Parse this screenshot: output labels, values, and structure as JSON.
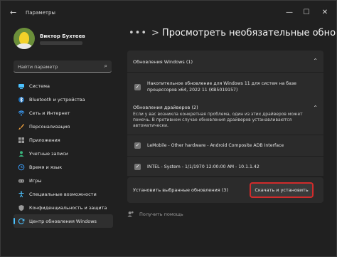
{
  "window": {
    "title": "Параметры",
    "back_icon": "back-arrow-icon",
    "controls": {
      "minimize": "—",
      "maximize": "☐",
      "close": "✕"
    }
  },
  "profile": {
    "name": "Виктор Бухтеев"
  },
  "search": {
    "placeholder": "Найти параметр"
  },
  "sidebar": {
    "items": [
      {
        "label": "Система",
        "icon": "monitor-icon",
        "color": "#4cc2ff",
        "active": false
      },
      {
        "label": "Bluetooth и устройства",
        "icon": "bluetooth-icon",
        "color": "#4cc2ff",
        "active": false
      },
      {
        "label": "Сеть и Интернет",
        "icon": "wifi-icon",
        "color": "#3aa0ff",
        "active": false
      },
      {
        "label": "Персонализация",
        "icon": "brush-icon",
        "color": "#e69a3c",
        "active": false
      },
      {
        "label": "Приложения",
        "icon": "apps-icon",
        "color": "#9a9a9a",
        "active": false
      },
      {
        "label": "Учетные записи",
        "icon": "person-icon",
        "color": "#39b27b",
        "active": false
      },
      {
        "label": "Время и язык",
        "icon": "globe-clock-icon",
        "color": "#3aa0ff",
        "active": false
      },
      {
        "label": "Игры",
        "icon": "gamepad-icon",
        "color": "#9a9a9a",
        "active": false
      },
      {
        "label": "Специальные возможности",
        "icon": "accessibility-icon",
        "color": "#4cc2ff",
        "active": false
      },
      {
        "label": "Конфиденциальность и защита",
        "icon": "shield-icon",
        "color": "#9a9a9a",
        "active": false
      },
      {
        "label": "Центр обновления Windows",
        "icon": "update-icon",
        "color": "#4cc2ff",
        "active": true
      }
    ]
  },
  "breadcrumb": {
    "dots": "•••",
    "chevron": ">",
    "title": "Просмотреть необязательные обно"
  },
  "windows_updates": {
    "header": "Обновления Windows (1)",
    "items": [
      {
        "text_line1": "Накопительное обновление для Windows 11 для систем на базе",
        "text_line2": "процессоров x64, 2022 11 (KB5019157)",
        "checked": true
      }
    ]
  },
  "driver_updates": {
    "header": "Обновления драйверов (2)",
    "description_line1": "Если у вас возникла конкретная проблема, один из этих драйверов может",
    "description_line2": "помочь. В противном случае обновления драйверов устанавливаются",
    "description_line3": "автоматически.",
    "items": [
      {
        "text": "LeMobile - Other hardware - Android Composite ADB Interface",
        "checked": true
      },
      {
        "text": "INTEL - System - 1/1/1970 12:00:00 AM - 10.1.1.42",
        "checked": true
      }
    ]
  },
  "install": {
    "label": "Установить выбранные обновления (3)",
    "button": "Скачать и установить",
    "highlight_color": "#d12b2b"
  },
  "help": {
    "label": "Получить помощь",
    "icon": "help-person-icon"
  }
}
